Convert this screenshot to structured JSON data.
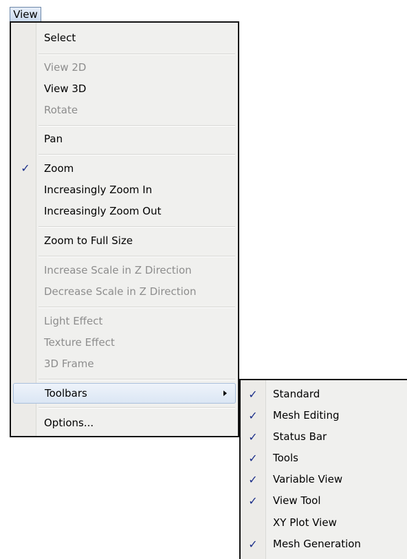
{
  "menubar": {
    "title": "View"
  },
  "menu": {
    "select": "Select",
    "view2d": "View 2D",
    "view3d": "View 3D",
    "rotate": "Rotate",
    "pan": "Pan",
    "zoom": "Zoom",
    "zoom_in": "Increasingly Zoom In",
    "zoom_out": "Increasingly Zoom Out",
    "zoom_full": "Zoom to Full Size",
    "increase_scale": "Increase Scale in Z Direction",
    "decrease_scale": "Decrease Scale in Z Direction",
    "light_effect": "Light Effect",
    "texture_effect": "Texture Effect",
    "frame_3d": "3D Frame",
    "toolbars": "Toolbars",
    "options": "Options...",
    "check_glyph": "✓"
  },
  "toolbars_submenu": {
    "standard": "Standard",
    "mesh_editing": "Mesh Editing",
    "status_bar": "Status Bar",
    "tools": "Tools",
    "variable_view": "Variable View",
    "view_tool": "View Tool",
    "xy_plot_view": "XY Plot View",
    "mesh_generation": "Mesh Generation",
    "check_glyph": "✓"
  },
  "state": {
    "zoom_checked": true,
    "toolbars_checked": [
      "Standard",
      "Mesh Editing",
      "Status Bar",
      "Tools",
      "Variable View",
      "View Tool",
      "Mesh Generation"
    ],
    "disabled_items": [
      "View 2D",
      "Rotate",
      "Increase Scale in Z Direction",
      "Decrease Scale in Z Direction",
      "Light Effect",
      "Texture Effect",
      "3D Frame"
    ],
    "highlighted_item": "Toolbars"
  },
  "colors": {
    "menu_bg": "#f0f0ee",
    "disabled_text": "#8d8d8d",
    "check": "#1c2f8a",
    "highlight": "#dbe6f4"
  },
  "icons": {
    "check": "checkmark-icon",
    "submenu_arrow": "chevron-right-icon"
  }
}
